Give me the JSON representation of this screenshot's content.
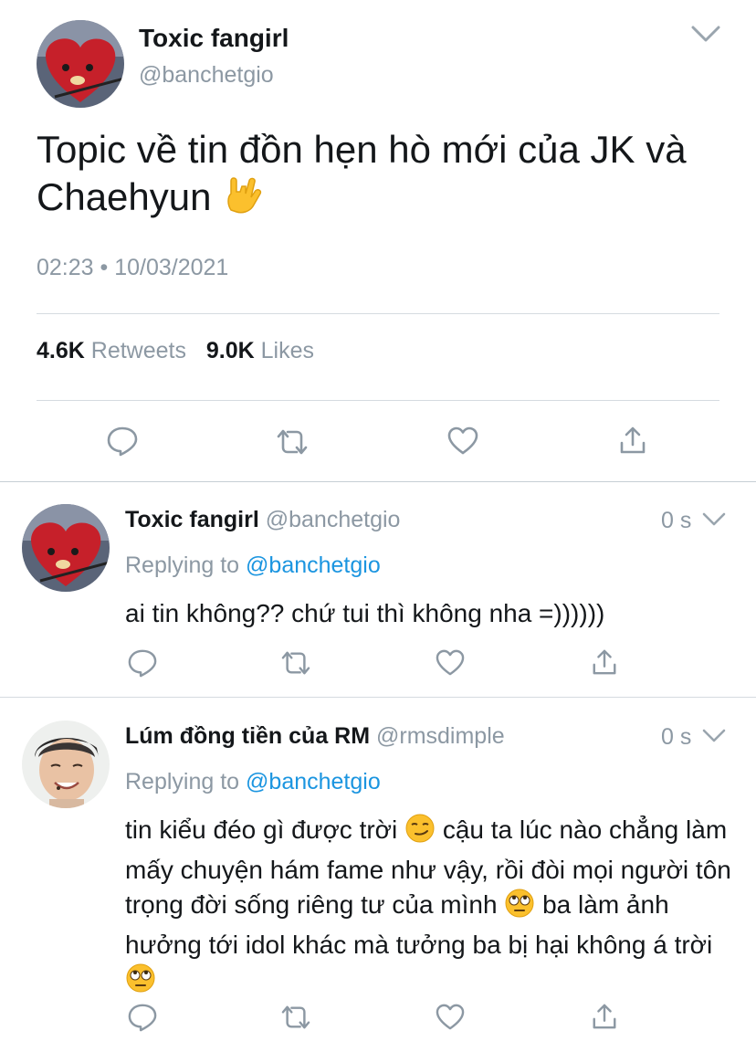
{
  "main_tweet": {
    "display_name": "Toxic fangirl",
    "handle": "@banchetgio",
    "text": "Topic về tin đồn hẹn hò mới của JK và Chaehyun",
    "emoji_name": "love-you-gesture",
    "timestamp": "02:23 • 10/03/2021",
    "retweets_count": "4.6K",
    "retweets_label": "Retweets",
    "likes_count": "9.0K",
    "likes_label": "Likes"
  },
  "replies": [
    {
      "display_name": "Toxic fangirl",
      "handle": "@banchetgio",
      "time": "0 s",
      "replying_label": "Replying to",
      "replying_handle": "@banchetgio",
      "text": "ai tin không?? chứ tui thì không nha =))))))"
    },
    {
      "display_name": "Lúm đồng tiền của RM",
      "handle": "@rmsdimple",
      "time": "0 s",
      "replying_label": "Replying to",
      "replying_handle": "@banchetgio",
      "text_part1": "tin kiểu đéo gì được trời",
      "text_part2": "cậu ta lúc nào chẳng làm mấy chuyện hám fame như vậy, rồi đòi mọi người tôn trọng đời sống riêng tư của mình",
      "text_part3": "ba làm ảnh hưởng tới idol khác mà tưởng ba bị hại không á trời",
      "emoji_names": [
        "smirking-face",
        "eye-roll-face",
        "eye-roll-face"
      ]
    }
  ],
  "colors": {
    "accent": "#1b95e0",
    "muted": "#8c98a3",
    "divider": "#d5dbe0"
  }
}
